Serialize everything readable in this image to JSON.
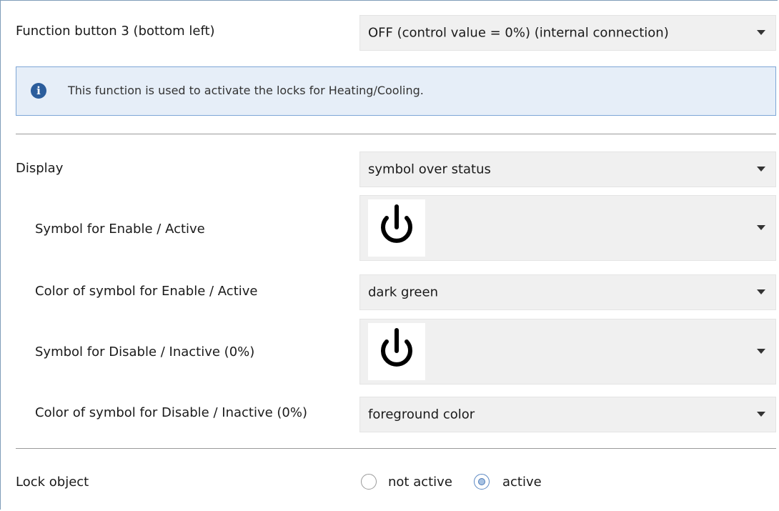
{
  "function_button": {
    "label": "Function button 3 (bottom left)",
    "value": "OFF (control value = 0%) (internal connection)"
  },
  "info": {
    "icon": "info-icon",
    "glyph": "i",
    "text": "This function is used to activate the locks for Heating/Cooling."
  },
  "display": {
    "label": "Display",
    "value": "symbol over status"
  },
  "symbol_enable": {
    "label": "Symbol for Enable / Active",
    "icon": "power-icon"
  },
  "color_enable": {
    "label": "Color of symbol for Enable / Active",
    "value": "dark green"
  },
  "symbol_disable": {
    "label": "Symbol for Disable / Inactive (0%)",
    "icon": "power-icon"
  },
  "color_disable": {
    "label": "Color of symbol for Disable / Inactive (0%)",
    "value": "foreground color"
  },
  "lock_object": {
    "label": "Lock object",
    "options": [
      {
        "label": "not active",
        "selected": false
      },
      {
        "label": "active",
        "selected": true
      }
    ]
  },
  "colors": {
    "info_background": "#e6eef8",
    "info_border": "#7ea6d6",
    "info_icon": "#2b5d9c",
    "dropdown_background": "#f0f0f0"
  }
}
